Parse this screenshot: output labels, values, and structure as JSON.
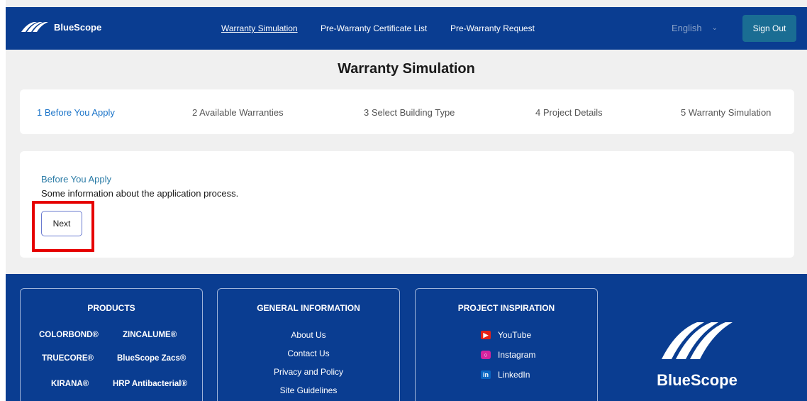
{
  "header": {
    "brand": "BlueScope",
    "nav": [
      {
        "label": "Warranty Simulation"
      },
      {
        "label": "Pre-Warranty Certificate List"
      },
      {
        "label": "Pre-Warranty Request"
      }
    ],
    "language": "English",
    "sign_out": "Sign Out"
  },
  "page": {
    "title": "Warranty Simulation"
  },
  "stepper": {
    "steps": [
      {
        "label": "1 Before You Apply"
      },
      {
        "label": "2 Available Warranties"
      },
      {
        "label": "3 Select Building Type"
      },
      {
        "label": "4 Project Details"
      },
      {
        "label": "5 Warranty Simulation"
      }
    ],
    "active_index": 0
  },
  "content": {
    "heading": "Before You Apply",
    "text": "Some information about the application process.",
    "next_label": "Next"
  },
  "footer": {
    "products": {
      "heading": "PRODUCTS",
      "items": [
        "COLORBOND®",
        "ZINCALUME®",
        "TRUECORE®",
        "BlueScope Zacs®",
        "KIRANA®",
        "HRP Antibacterial®"
      ]
    },
    "general": {
      "heading": "GENERAL INFORMATION",
      "links": [
        "About Us",
        "Contact Us",
        "Privacy and Policy",
        "Site Guidelines"
      ]
    },
    "inspiration": {
      "heading": "PROJECT INSPIRATION",
      "links": [
        {
          "label": "YouTube",
          "icon": "youtube-icon"
        },
        {
          "label": "Instagram",
          "icon": "instagram-icon"
        },
        {
          "label": "LinkedIn",
          "icon": "linkedin-icon"
        }
      ]
    },
    "brand": "BlueScope"
  },
  "colors": {
    "brand_blue": "#0a3d91",
    "accent_teal": "#1a6d93",
    "active_step": "#1a73c8",
    "highlight_red": "#e60000"
  }
}
